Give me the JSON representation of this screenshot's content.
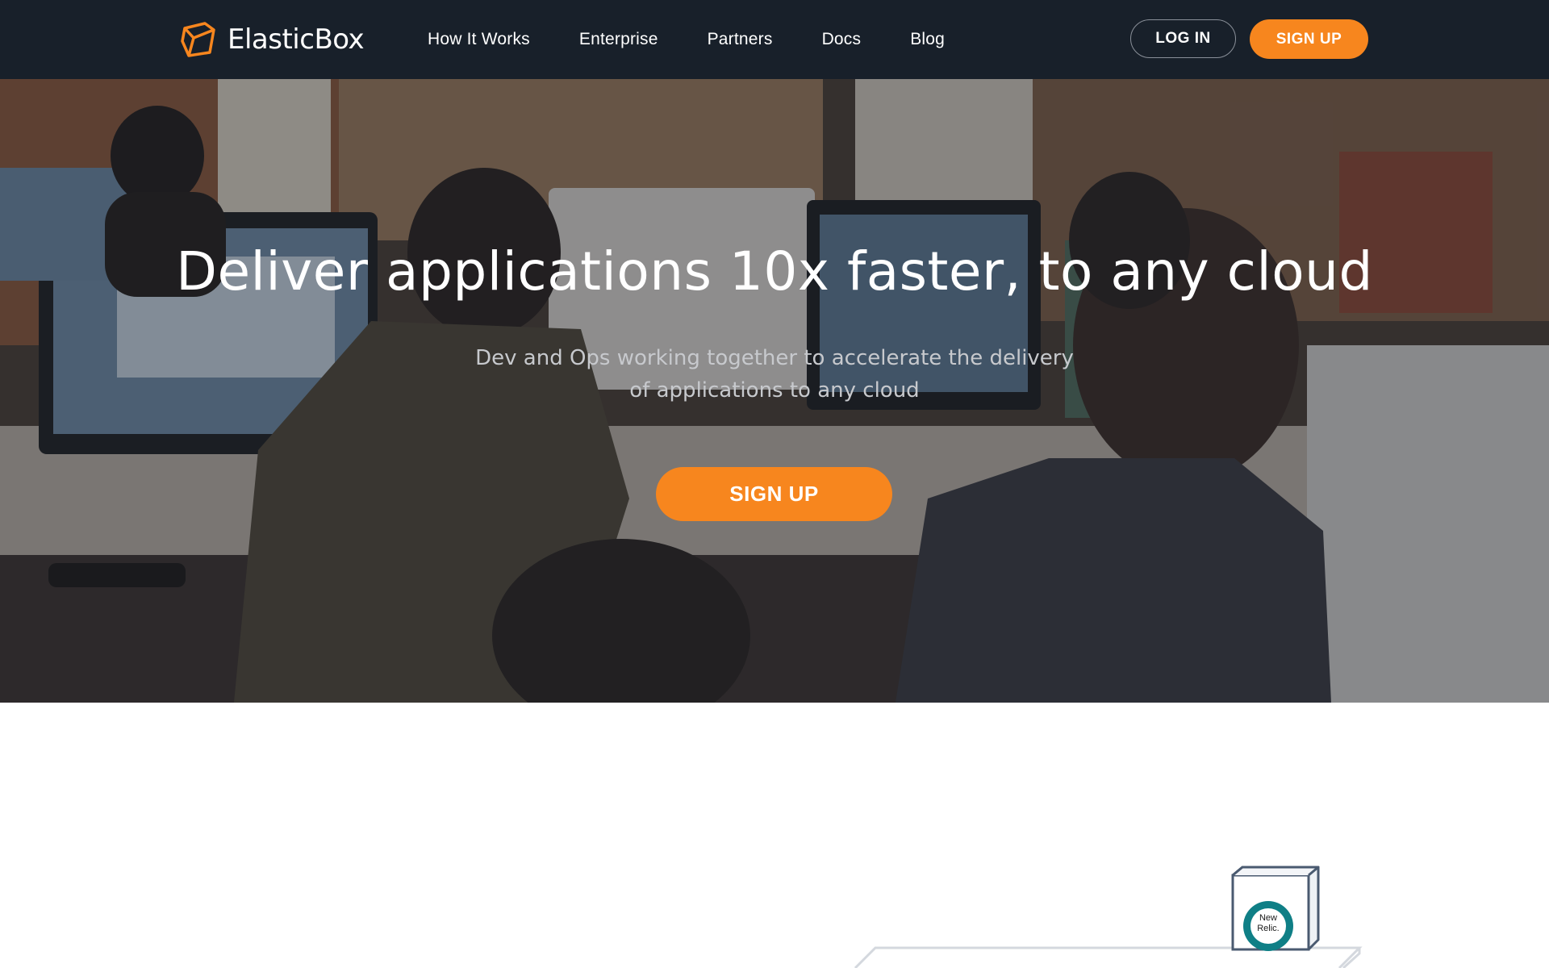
{
  "header": {
    "brand": "ElasticBox",
    "nav": [
      {
        "label": "How It Works"
      },
      {
        "label": "Enterprise"
      },
      {
        "label": "Partners"
      },
      {
        "label": "Docs"
      },
      {
        "label": "Blog"
      }
    ],
    "login_label": "LOG IN",
    "signup_label": "SIGN UP"
  },
  "hero": {
    "title": "Deliver applications 10x faster, to any cloud",
    "subtitle_line1": "Dev and Ops working together to accelerate the delivery",
    "subtitle_line2": "of applications to any cloud",
    "cta_label": "SIGN UP"
  },
  "illustration": {
    "box_logo_line1": "New",
    "box_logo_line2": "Relic."
  },
  "colors": {
    "header_bg": "#18202a",
    "accent_orange": "#f7861e",
    "white": "#ffffff"
  }
}
